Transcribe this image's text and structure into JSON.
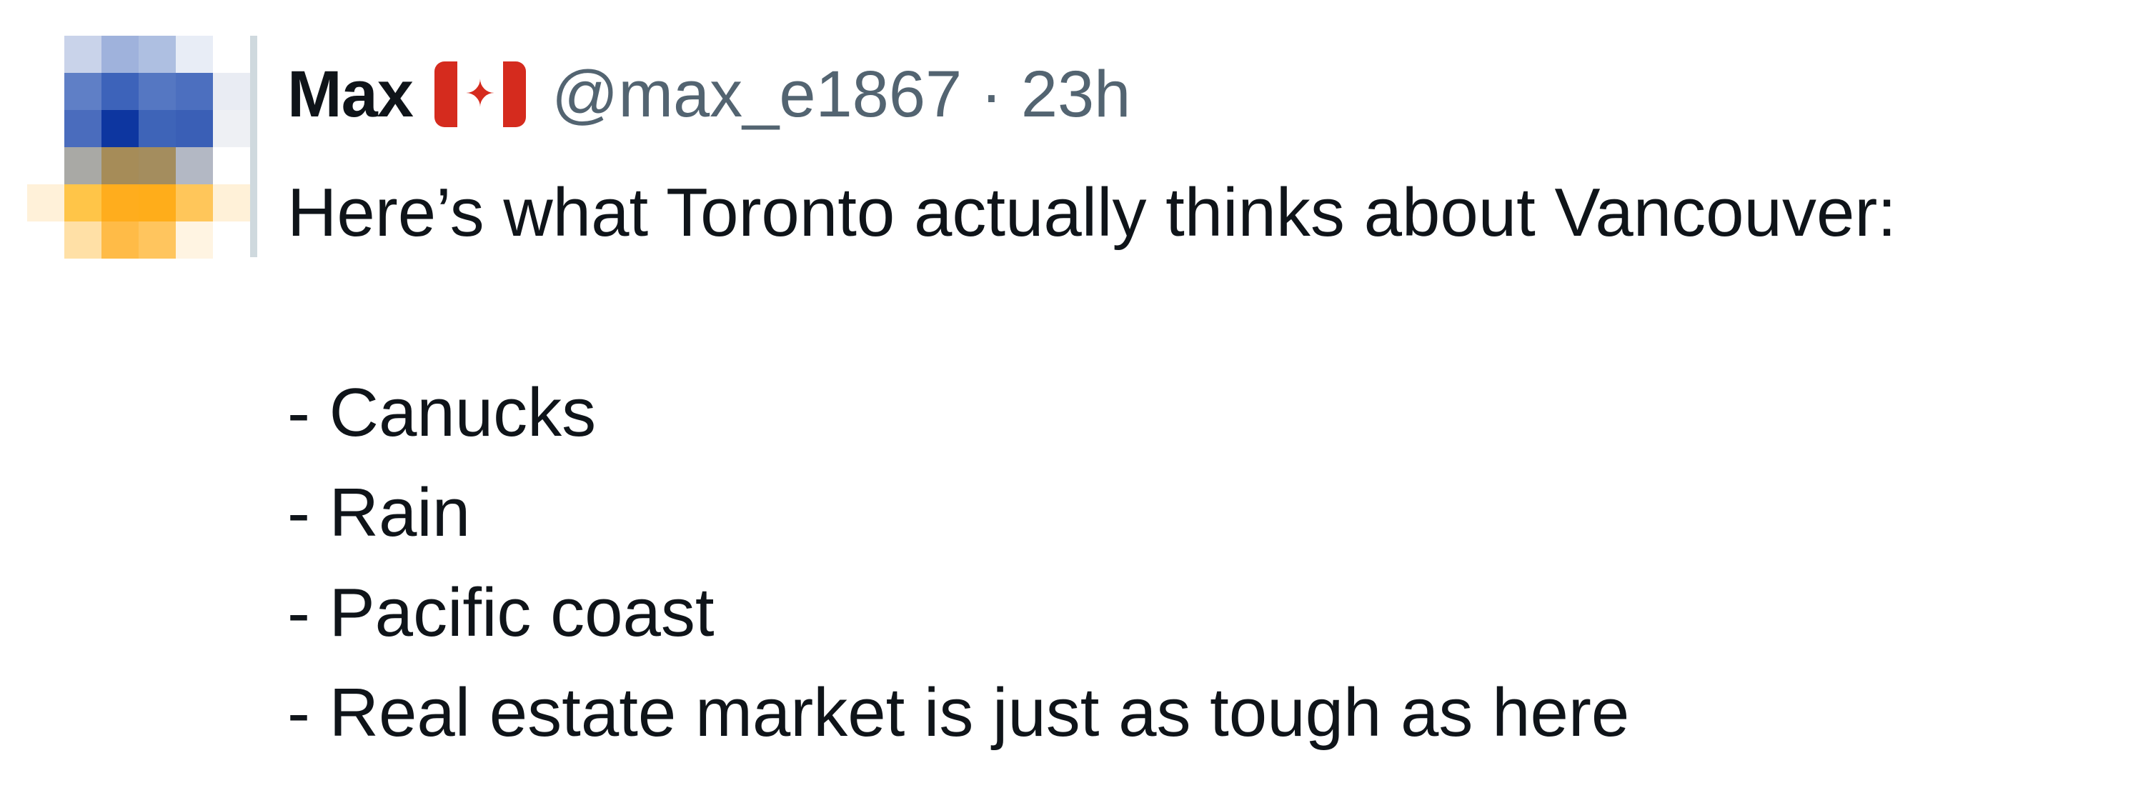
{
  "tweet": {
    "author_name": "Max",
    "flag_icon": "canada-flag-icon",
    "handle": "@max_e1867",
    "separator": "·",
    "time": "23h",
    "lines": [
      "Here’s what Toronto actually thinks about Vancouver:",
      "",
      "- Canucks",
      "- Rain",
      "- Pacific coast",
      "- Real estate market is just as tough as here"
    ]
  },
  "colors": {
    "text": "#0f1419",
    "secondary_text": "#536471",
    "flag_red": "#d52b1e",
    "thread_line": "#cfd9de"
  }
}
